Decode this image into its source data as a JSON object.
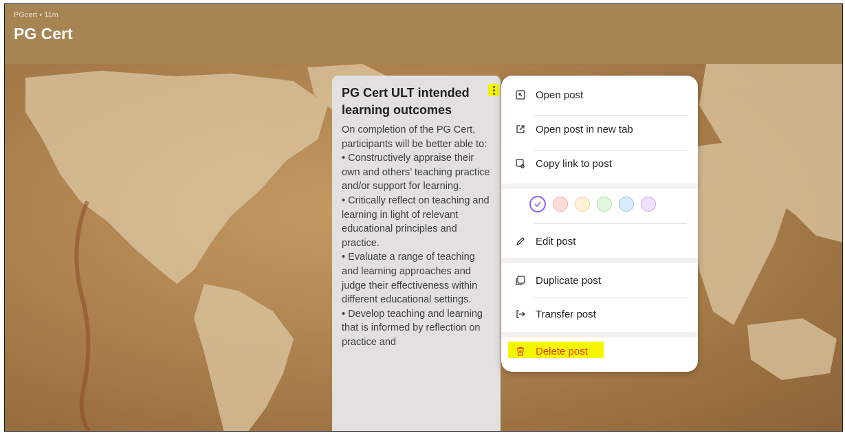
{
  "header": {
    "meta": "PGcert • 11m",
    "title": "PG Cert"
  },
  "post": {
    "title": "PG Cert ULT intended learning outcomes",
    "body": "On completion of the PG Cert, participants will be better able to:\n• Constructively appraise their own and others’ teaching practice and/or support for learning.\n• Critically reflect on teaching and learning in light of relevant educational principles and practice.\n• Evaluate a range of teaching and learning approaches and judge their effectiveness within different educational settings.\n• Develop teaching and learning that is informed by reflection on practice and"
  },
  "menu": {
    "items": [
      {
        "label": "Open post",
        "icon": "expand-icon"
      },
      {
        "label": "Open post in new tab",
        "icon": "external-link-icon"
      },
      {
        "label": "Copy link to post",
        "icon": "link-icon"
      },
      {
        "label": "Edit post",
        "icon": "pencil-icon"
      },
      {
        "label": "Duplicate post",
        "icon": "duplicate-icon"
      },
      {
        "label": "Transfer post",
        "icon": "transfer-icon"
      },
      {
        "label": "Delete post",
        "icon": "trash-icon"
      }
    ],
    "colors": [
      {
        "name": "white",
        "fill": "#ffffff",
        "border": "#8b5cf6",
        "selected": true
      },
      {
        "name": "red",
        "fill": "#fddcdc",
        "border": "#f4a9a9"
      },
      {
        "name": "yellow",
        "fill": "#fdf2d6",
        "border": "#f0d39a"
      },
      {
        "name": "green",
        "fill": "#e2f6de",
        "border": "#a9dfa0"
      },
      {
        "name": "blue",
        "fill": "#d6ecfb",
        "border": "#8fc8ee"
      },
      {
        "name": "purple",
        "fill": "#efe0fb",
        "border": "#c9a6ee"
      }
    ]
  },
  "colors": {
    "header_bg": "#a78453",
    "post_bg": "#e2e1df",
    "delete_text": "#e0421b",
    "highlight": "#f5f500",
    "selected_ring": "#8b5cf6"
  }
}
